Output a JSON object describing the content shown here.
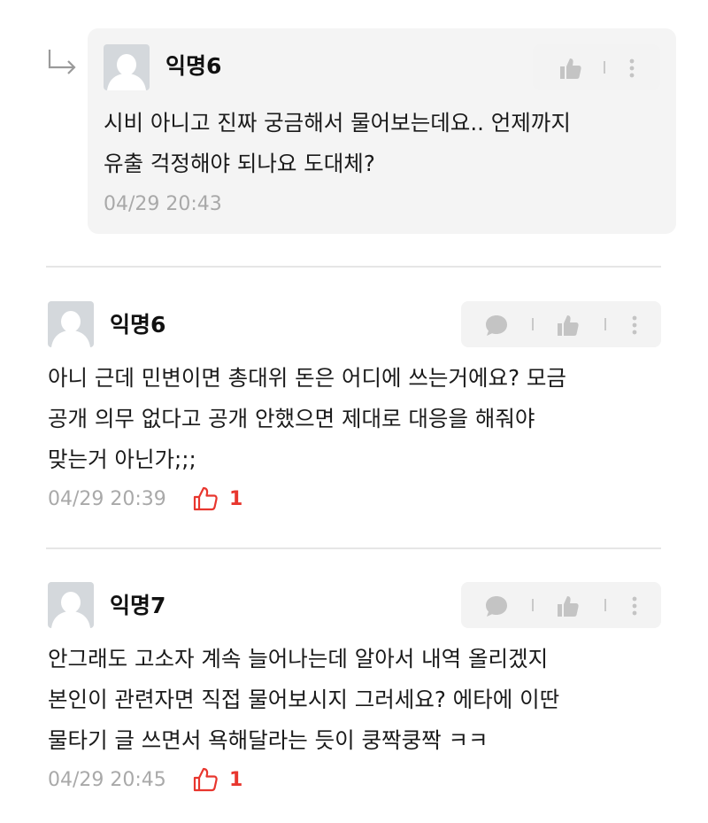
{
  "colors": {
    "card_bg": "#f4f4f4",
    "avatar_bg": "#d4d8dc",
    "meta_text": "#a9a9a9",
    "like_red": "#e8362e",
    "icon_gray": "#c4c4c4"
  },
  "reply": {
    "author": "익명6",
    "lines": [
      "시비 아니고 진짜 궁금해서 물어보는데요.. 언제까지",
      "유출 걱정해야 되나요 도대체?"
    ],
    "timestamp": "04/29 20:43"
  },
  "comments": [
    {
      "author": "익명6",
      "lines": [
        "아니 근데 민변이면 총대위 돈은 어디에 쓰는거에요? 모금",
        "공개 의무 없다고 공개 안했으면 제대로 대응을 해줘야",
        "맞는거 아닌가;;;"
      ],
      "timestamp": "04/29 20:39",
      "likes": "1"
    },
    {
      "author": "익명7",
      "lines": [
        "안그래도 고소자 계속 늘어나는데 알아서 내역 올리겠지",
        "본인이 관련자면 직접 물어보시지 그러세요? 에타에 이딴",
        "물타기 글 쓰면서 욕해달라는 듯이 쿵짝쿵짝 ㅋㅋ"
      ],
      "timestamp": "04/29 20:45",
      "likes": "1"
    }
  ]
}
